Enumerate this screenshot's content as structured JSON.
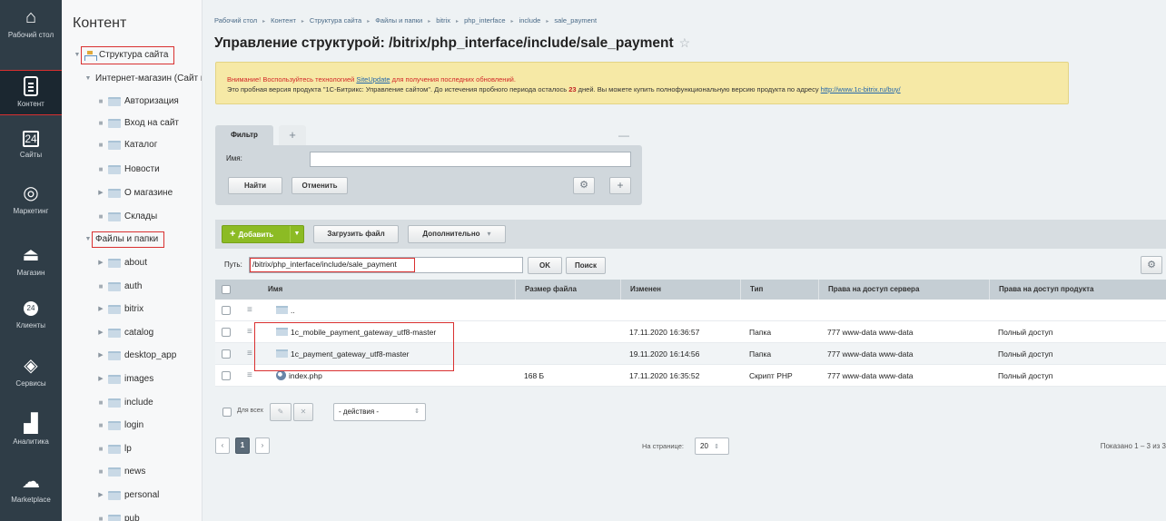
{
  "rail": [
    {
      "label": "Рабочий стол",
      "icon": "home-icon"
    },
    {
      "label": "Контент",
      "icon": "document-icon",
      "active": true
    },
    {
      "label": "Сайты",
      "icon": "calendar-icon"
    },
    {
      "label": "Маркетинг",
      "icon": "target-icon"
    },
    {
      "label": "Магазин",
      "icon": "cart-icon"
    },
    {
      "label": "Клиенты",
      "icon": "clock-icon"
    },
    {
      "label": "Сервисы",
      "icon": "layers-icon"
    },
    {
      "label": "Аналитика",
      "icon": "bar-chart-icon"
    },
    {
      "label": "Marketplace",
      "icon": "cloud-download-icon"
    }
  ],
  "rail_icon_glyphs": {
    "calendar": "24",
    "clients": "24"
  },
  "tree": {
    "title": "Контент",
    "root": "Структура сайта",
    "site": "Интернет-магазин (Сайт по",
    "site_items": [
      "Авторизация",
      "Вход на сайт",
      "Каталог",
      "Новости",
      "О магазине",
      "Склады"
    ],
    "files_root": "Файлы и папки",
    "file_items": [
      "about",
      "auth",
      "bitrix",
      "catalog",
      "desktop_app",
      "images",
      "include",
      "login",
      "lp",
      "news",
      "personal",
      "pub"
    ]
  },
  "breadcrumbs": [
    "Рабочий стол",
    "Контент",
    "Структура сайта",
    "Файлы и папки",
    "bitrix",
    "php_interface",
    "include",
    "sale_payment"
  ],
  "page_title": "Управление структурой: /bitrix/php_interface/include/sale_payment",
  "notice": {
    "warn_before": "Внимание! Воспользуйтесь технологией ",
    "warn_link": "SiteUpdate",
    "warn_after": " для получения последних обновлений.",
    "line2_before": "Это пробная версия продукта \"1С-Битрикс: Управление сайтом\". До истечения пробного периода осталось ",
    "days": "23",
    "line2_mid": " дней. Вы можете купить полнофункциональную версию продукта по адресу ",
    "line2_link": "http://www.1c-bitrix.ru/buy/"
  },
  "filter": {
    "tab": "Фильтр",
    "name_label": "Имя:",
    "name_value": "",
    "find": "Найти",
    "cancel": "Отменить"
  },
  "toolbar": {
    "add": "Добавить",
    "upload": "Загрузить файл",
    "more": "Дополнительно"
  },
  "path": {
    "label": "Путь:",
    "value": "/bitrix/php_interface/include/sale_payment",
    "ok": "OK",
    "search": "Поиск"
  },
  "table": {
    "headers": [
      "Имя",
      "Размер файла",
      "Изменен",
      "Тип",
      "Права на доступ сервера",
      "Права на доступ продукта"
    ],
    "up": "..",
    "rows": [
      {
        "name": "1c_mobile_payment_gateway_utf8-master",
        "size": "",
        "modified": "17.11.2020 16:36:57",
        "type": "Папка",
        "server": "777 www-data www-data",
        "product": "Полный доступ",
        "kind": "folder"
      },
      {
        "name": "1c_payment_gateway_utf8-master",
        "size": "",
        "modified": "19.11.2020 16:14:56",
        "type": "Папка",
        "server": "777 www-data www-data",
        "product": "Полный доступ",
        "kind": "folder"
      },
      {
        "name": "index.php",
        "size": "168 Б",
        "modified": "17.11.2020 16:35:52",
        "type": "Скрипт PHP",
        "server": "777 www-data www-data",
        "product": "Полный доступ",
        "kind": "php"
      }
    ]
  },
  "bulk": {
    "label": "Для всех",
    "actions": "- действия -"
  },
  "pager": {
    "current": "1",
    "perpage_label": "На странице:",
    "perpage": "20",
    "shown": "Показано 1 – 3 из 3"
  }
}
